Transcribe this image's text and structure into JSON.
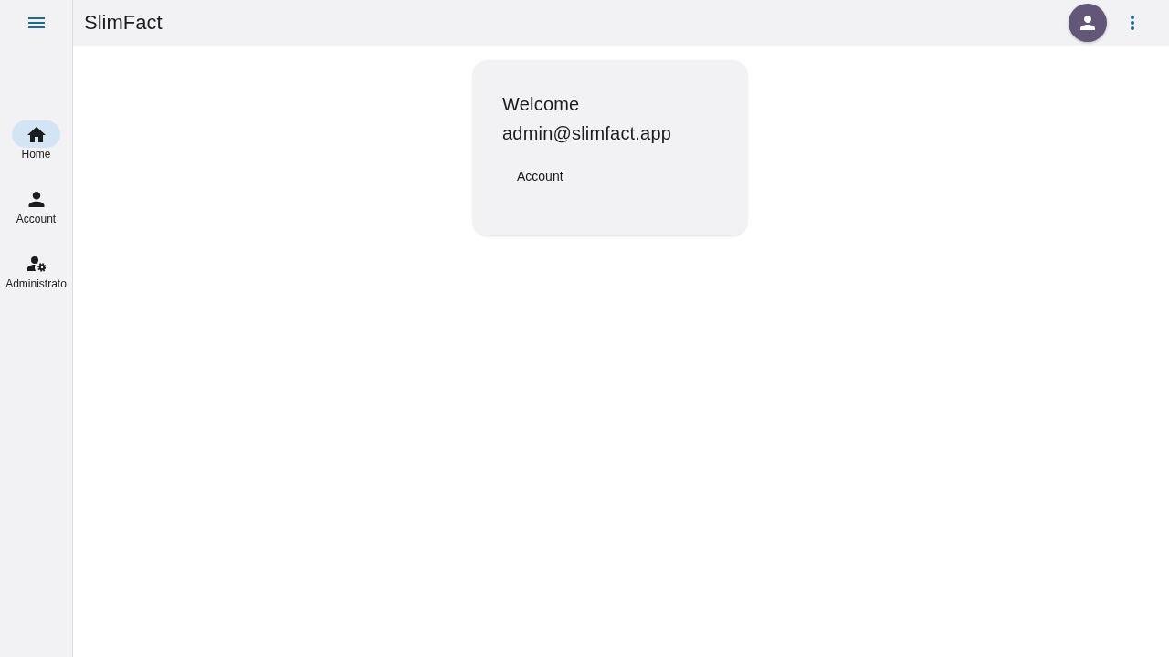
{
  "nav_rail": {
    "items": [
      {
        "kind": "home",
        "label": "Home",
        "selected": true
      },
      {
        "kind": "account",
        "label": "Account",
        "selected": false
      },
      {
        "kind": "admin",
        "label": "Administrato",
        "selected": false
      }
    ]
  },
  "top_bar": {
    "title": "SlimFact"
  },
  "welcome_card": {
    "heading": "Welcome admin@slimfact.app",
    "buttons": [
      "Account"
    ]
  }
}
